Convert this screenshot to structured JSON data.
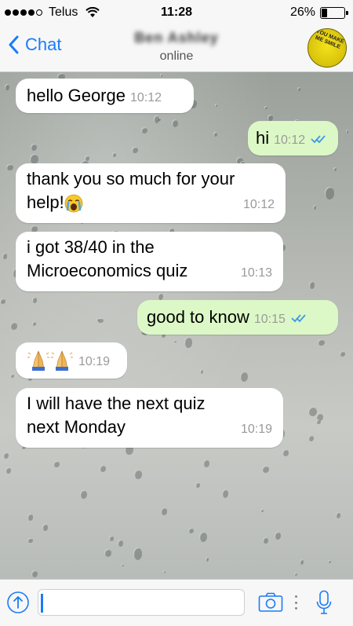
{
  "status_bar": {
    "carrier": "Telus",
    "time": "11:28",
    "battery_percent": "26%",
    "battery_level": 0.26
  },
  "nav": {
    "back_label": "Chat",
    "contact_name": "Ben Ashley",
    "contact_status": "online",
    "avatar_text": "YOU MAKE ME SMILE"
  },
  "messages": [
    {
      "direction": "in",
      "text": "hello George",
      "time": "10:12"
    },
    {
      "direction": "out",
      "text": "hi",
      "time": "10:12",
      "read": true
    },
    {
      "direction": "in",
      "text": "thank you so much for your help!",
      "emoji": "loudly-crying-face",
      "time": "10:12"
    },
    {
      "direction": "in",
      "text": "i got 38/40 in the Microeconomics quiz",
      "time": "10:13"
    },
    {
      "direction": "out",
      "text": "good to know",
      "time": "10:15",
      "read": true
    },
    {
      "direction": "in",
      "emoji": "folded-hands x2",
      "time": "10:19"
    },
    {
      "direction": "in",
      "text": "I will have the next quiz next Monday",
      "time": "10:19"
    }
  ],
  "msg_texts": {
    "m0": "hello George",
    "m1": "hi",
    "m2a": "thank you so much for your",
    "m2b": "help!",
    "m3a": "i got 38/40 in the",
    "m3b": "Microeconomics quiz",
    "m4": "good to know",
    "m6a": "I will have the next quiz",
    "m6b": "next Monday"
  },
  "msg_times": {
    "m0": "10:12",
    "m1": "10:12",
    "m2": "10:12",
    "m3": "10:13",
    "m4": "10:15",
    "m5": "10:19",
    "m6": "10:19"
  },
  "input": {
    "value": "",
    "placeholder": ""
  },
  "colors": {
    "accent": "#1a7cf7",
    "outgoing_bubble": "#dcf8c6",
    "incoming_bubble": "#ffffff",
    "read_ticks": "#3d9ae8"
  }
}
